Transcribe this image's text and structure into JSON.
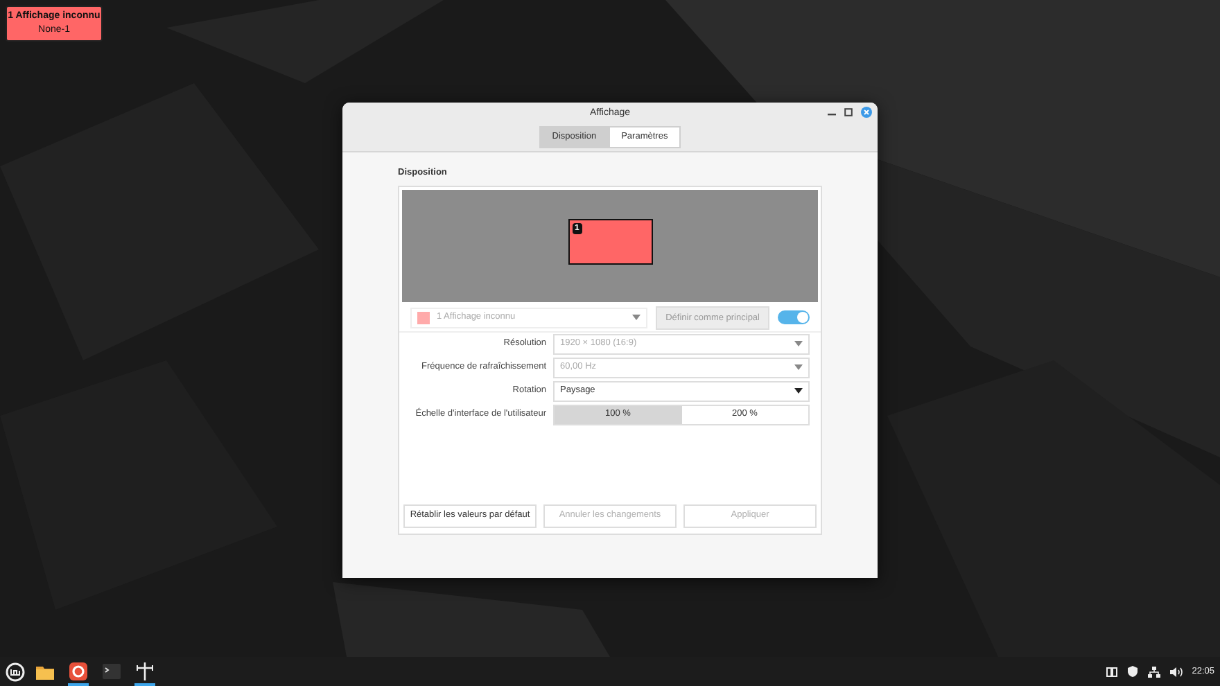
{
  "overlay_label": {
    "number": "1",
    "name": "Affichage inconnu",
    "connector": "None-1"
  },
  "window": {
    "title": "Affichage"
  },
  "tabs": [
    {
      "label": "Disposition",
      "selected": true
    },
    {
      "label": "Paramètres",
      "selected": false
    }
  ],
  "section_title": "Disposition",
  "monitors": [
    {
      "number": "1"
    }
  ],
  "display_row": {
    "number": "1",
    "name": "Affichage inconnu",
    "disabled": true,
    "primary_button": {
      "label": "Définir comme principal",
      "disabled": true
    },
    "on": true
  },
  "settings": [
    {
      "label": "Résolution",
      "value": "1920 × 1080 (16:9)",
      "disabled": true
    },
    {
      "label": "Fréquence de rafraîchissement",
      "value": "60,00 Hz",
      "disabled": true
    },
    {
      "label": "Rotation",
      "value": "Paysage",
      "disabled": false
    }
  ],
  "scale": {
    "label": "Échelle d'interface de l'utilisateur",
    "options": [
      {
        "label": "100 %",
        "selected": true
      },
      {
        "label": "200 %",
        "selected": false
      }
    ]
  },
  "buttons": [
    {
      "label": "Rétablir les valeurs par défaut",
      "disabled": false
    },
    {
      "label": "Annuler les changements",
      "disabled": true
    },
    {
      "label": "Appliquer",
      "disabled": true
    }
  ],
  "taskbar": {
    "apps": [
      {
        "kind": "files",
        "running": false
      },
      {
        "kind": "browser",
        "running": true
      },
      {
        "kind": "terminal",
        "running": false
      },
      {
        "kind": "display",
        "running": true
      }
    ],
    "clock": "22:05"
  }
}
